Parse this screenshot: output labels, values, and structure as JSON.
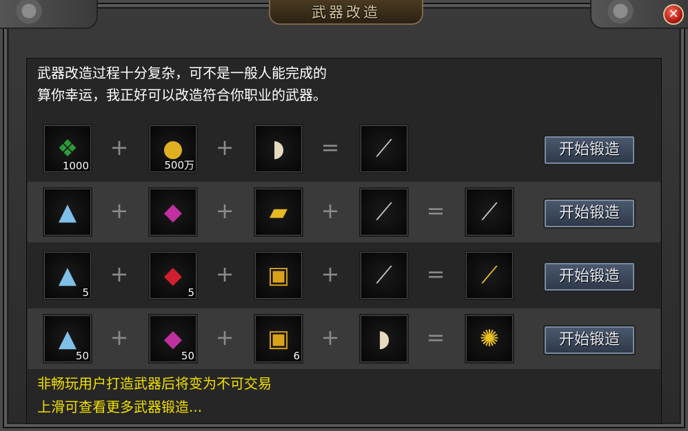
{
  "window": {
    "title": "武器改造"
  },
  "intro": {
    "line1": "武器改造过程十分复杂，可不是一般人能完成的",
    "line2": "算你幸运，我正好可以改造符合你职业的武器。"
  },
  "recipes": [
    {
      "inputs": [
        {
          "icon": "green-jade-icon",
          "qty": "1000"
        },
        {
          "icon": "gold-coins-icon",
          "qty": "500万"
        },
        {
          "icon": "folding-fan-icon",
          "qty": ""
        }
      ],
      "result": {
        "icon": "sword-icon",
        "qty": ""
      },
      "button": "开始锻造"
    },
    {
      "inputs": [
        {
          "icon": "crystal-ore-icon",
          "qty": ""
        },
        {
          "icon": "purple-gem-icon",
          "qty": ""
        },
        {
          "icon": "gold-bar-icon",
          "qty": ""
        },
        {
          "icon": "curved-blade-icon",
          "qty": ""
        }
      ],
      "result": {
        "icon": "curved-blade-icon",
        "qty": ""
      },
      "button": "开始锻造"
    },
    {
      "inputs": [
        {
          "icon": "crystal-ore-icon",
          "qty": "5"
        },
        {
          "icon": "ruby-icon",
          "qty": "5"
        },
        {
          "icon": "treasure-chest-icon",
          "qty": ""
        },
        {
          "icon": "curved-blade-icon",
          "qty": ""
        }
      ],
      "result": {
        "icon": "golden-blade-icon",
        "qty": ""
      },
      "button": "开始锻造"
    },
    {
      "inputs": [
        {
          "icon": "crystal-ore-icon",
          "qty": "50"
        },
        {
          "icon": "purple-gem-icon",
          "qty": "50"
        },
        {
          "icon": "treasure-chest-icon",
          "qty": "6"
        },
        {
          "icon": "folding-fan-icon",
          "qty": ""
        }
      ],
      "result": {
        "icon": "golden-fan-icon",
        "qty": ""
      },
      "button": "开始锻造"
    }
  ],
  "operators": {
    "plus": "+",
    "equals": "="
  },
  "close": "✕",
  "footer": {
    "line1": "非畅玩用户打造武器后将变为不可交易",
    "line2": "上滑可查看更多武器锻造..."
  }
}
